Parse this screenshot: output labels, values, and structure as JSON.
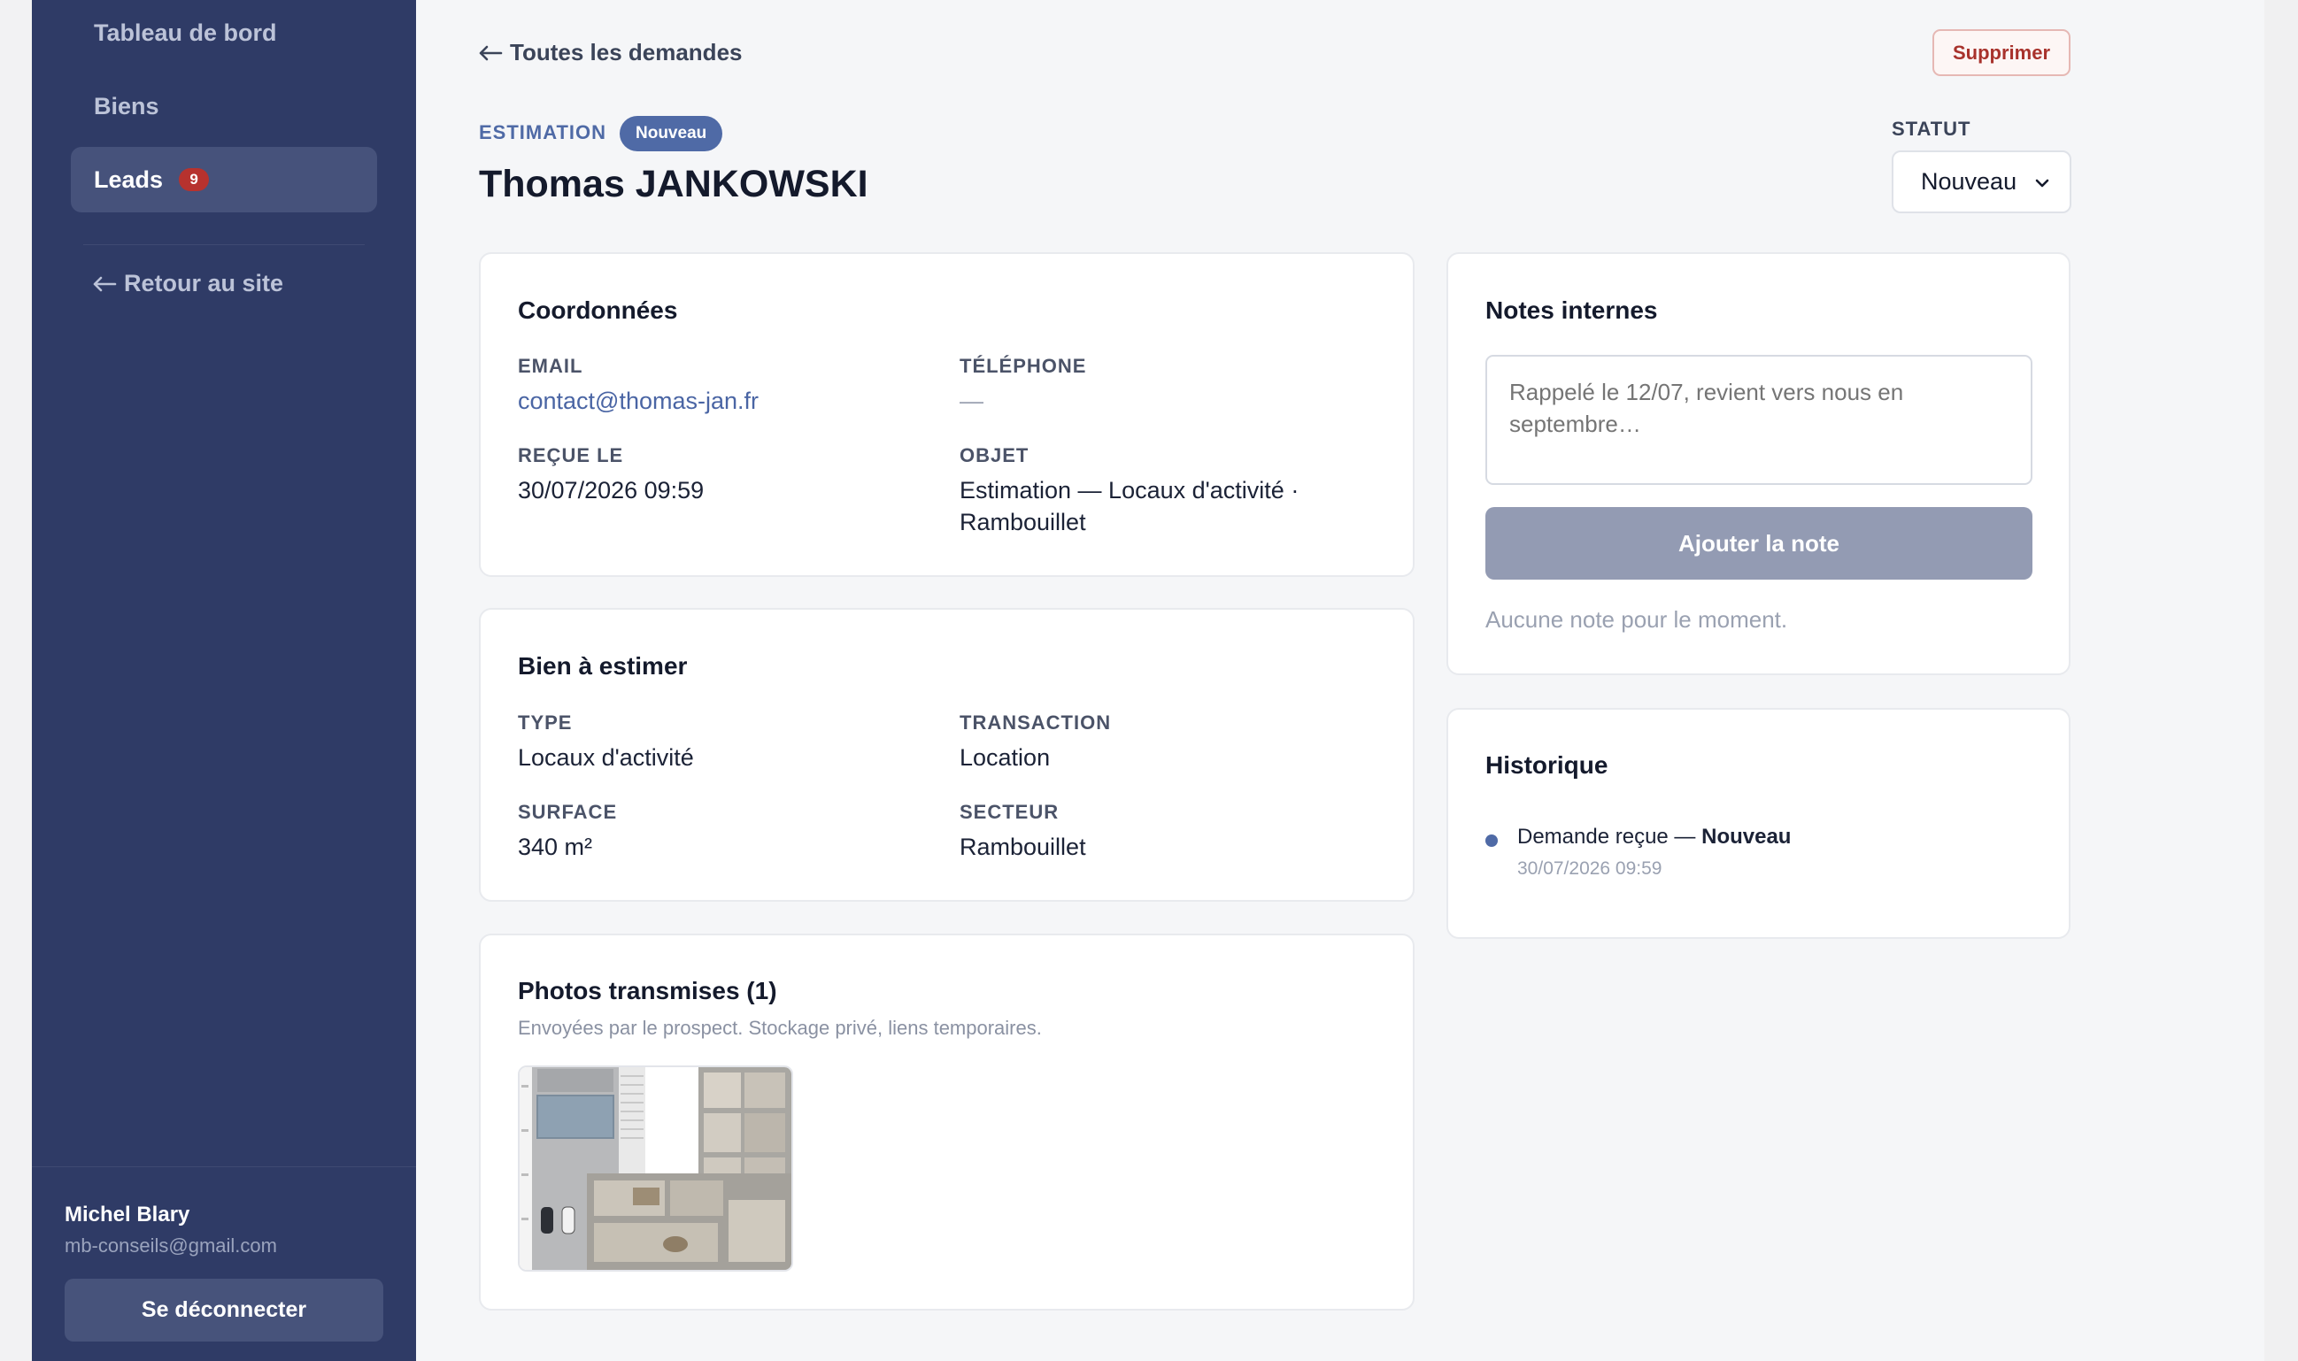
{
  "sidebar": {
    "items": [
      {
        "label": "Tableau de bord"
      },
      {
        "label": "Biens"
      },
      {
        "label": "Leads",
        "badge": "9"
      }
    ],
    "back_label": "Retour au site",
    "user": {
      "name": "Michel Blary",
      "email": "mb-conseils@gmail.com"
    },
    "logout_label": "Se déconnecter"
  },
  "header": {
    "back_label": "Toutes les demandes",
    "delete_label": "Supprimer",
    "type_label": "ESTIMATION",
    "status_pill": "Nouveau",
    "lead_name": "Thomas JANKOWSKI",
    "statut_label": "STATUT",
    "statut_value": "Nouveau"
  },
  "coordonnees": {
    "title": "Coordonnées",
    "email_label": "EMAIL",
    "email_value": "contact@thomas-jan.fr",
    "phone_label": "TÉLÉPHONE",
    "phone_value": "—",
    "received_label": "REÇUE LE",
    "received_value": "30/07/2026 09:59",
    "object_label": "OBJET",
    "object_line1": "Estimation — Locaux d'activité ·",
    "object_line2": "Rambouillet"
  },
  "bien": {
    "title": "Bien à estimer",
    "type_label": "TYPE",
    "type_value": "Locaux d'activité",
    "transaction_label": "TRANSACTION",
    "transaction_value": "Location",
    "surface_label": "SURFACE",
    "surface_value": "340 m²",
    "secteur_label": "SECTEUR",
    "secteur_value": "Rambouillet"
  },
  "photos": {
    "title": "Photos transmises (1)",
    "subtitle": "Envoyées par le prospect. Stockage privé, liens temporaires."
  },
  "notes": {
    "title": "Notes internes",
    "placeholder": "Rappelé le 12/07, revient vers nous en septembre…",
    "add_label": "Ajouter la note",
    "empty_label": "Aucune note pour le moment."
  },
  "historique": {
    "title": "Historique",
    "entries": [
      {
        "text": "Demande reçue — ",
        "status": "Nouveau",
        "date": "30/07/2026 09:59"
      }
    ]
  },
  "colors": {
    "sidebar_bg": "#2f3b66",
    "accent": "#4f6aa6",
    "badge_red": "#b7322e",
    "delete_red": "#a8322c"
  }
}
